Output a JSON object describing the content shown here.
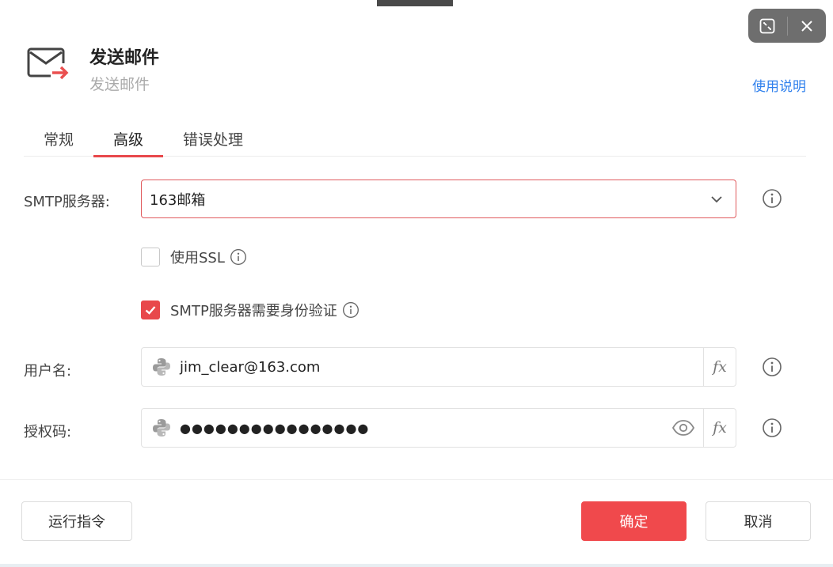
{
  "window": {
    "expand_icon": "expand-icon",
    "close_icon": "close-icon"
  },
  "header": {
    "title": "发送邮件",
    "subtitle": "发送邮件",
    "help_link": "使用说明",
    "icon": "send-mail-icon"
  },
  "tabs": [
    {
      "label": "常规",
      "active": false
    },
    {
      "label": "高级",
      "active": true
    },
    {
      "label": "错误处理",
      "active": false
    }
  ],
  "form": {
    "smtp_server": {
      "label": "SMTP服务器:",
      "value": "163邮箱"
    },
    "use_ssl": {
      "label": "使用SSL",
      "checked": false
    },
    "smtp_auth": {
      "label": "SMTP服务器需要身份验证",
      "checked": true
    },
    "username": {
      "label": "用户名:",
      "value": "jim_clear@163.com",
      "fx": "fx"
    },
    "auth_code": {
      "label": "授权码:",
      "value": "●●●●●●●●●●●●●●●●",
      "fx": "fx"
    }
  },
  "footer": {
    "run_command": "运行指令",
    "confirm": "确定",
    "cancel": "取消"
  },
  "colors": {
    "accent": "#e8484b",
    "primary_button": "#f0494c",
    "link": "#2f80ed"
  }
}
